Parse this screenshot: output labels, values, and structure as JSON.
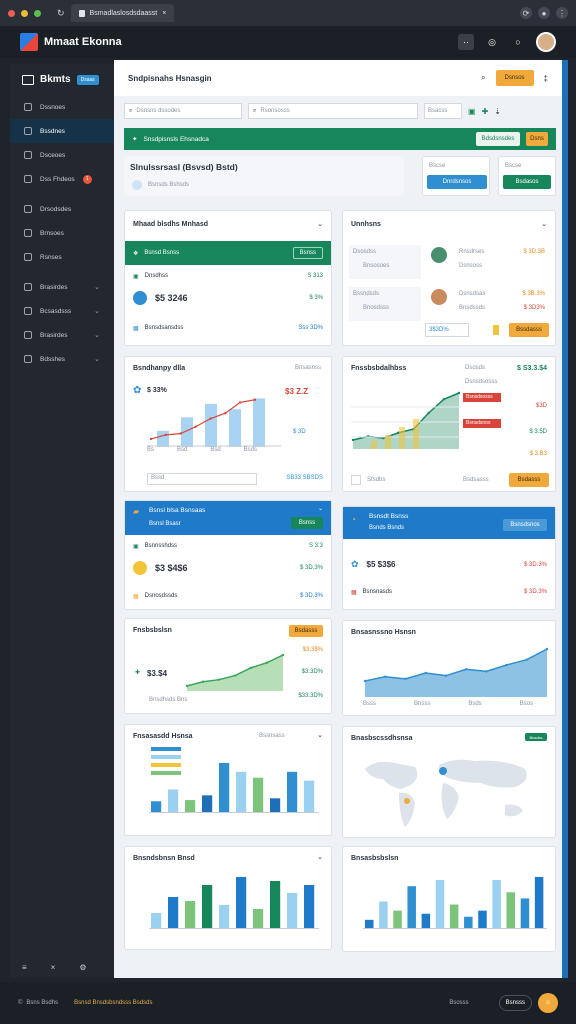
{
  "browser": {
    "tab_title": "Bsmadlaslosdsdaasst",
    "close": "×"
  },
  "app": {
    "name": "Mmaat Ekonna"
  },
  "sidebar": {
    "title": "Bkmts",
    "badge_label": "Dsaas",
    "items": [
      {
        "label": "Dssnoes",
        "icon": "home-icon"
      },
      {
        "label": "Bssdnes",
        "icon": "grid-icon"
      },
      {
        "label": "Dsceoes",
        "icon": "doc-icon"
      },
      {
        "label": "Dss Fhdeos",
        "icon": "user-icon",
        "badge": "1"
      },
      {
        "label": "Drsodsdes",
        "icon": "chart-icon"
      },
      {
        "label": "Brnsoes",
        "icon": "list-icon"
      },
      {
        "label": "Rsnses",
        "icon": "table-icon"
      },
      {
        "label": "Brasirdes",
        "icon": "layers-icon"
      },
      {
        "label": "Bcsasdsss",
        "icon": "cube-icon"
      },
      {
        "label": "Brasirdes",
        "icon": "box-icon"
      },
      {
        "label": "Bdsshes",
        "icon": "settings-icon"
      }
    ]
  },
  "topbar": {
    "title": "Sndpisnahs Hsnasgin",
    "action": "Dsnsos",
    "search1": "Dsnsns dssodes",
    "search2": "Rsonsosss",
    "filter": "Bsacss"
  },
  "banner": {
    "title": "Snsdpisnsls Ehsnadca",
    "btn1": "Bdsdsnsdes",
    "btn2": "Dsns"
  },
  "summary": {
    "title": "Slnulssrsasl (Bsvsd) Bstd)",
    "sub": "Bsnsds Bshsds",
    "btn_top": "Dnrdsnsos",
    "btn_bottom": "Bsdasos",
    "link": "Bscse"
  },
  "card_a": {
    "title": "Mhaad blsdhs Mnhasd",
    "bar": "Bsnsd Bsnss",
    "row1": "Dnsdhss",
    "row1_val": "S 313",
    "value": "$5 3246",
    "delta": "$ 3%",
    "row3": "Bsnsdsansdss",
    "row3_val": "Sss 3D%"
  },
  "card_b": {
    "title": "Unnhsns",
    "r1a": "Dsosdss",
    "r1b": "Bnsosoes",
    "r1val": "$ 3D.3B",
    "r2a": "Rnsdrses",
    "r2b": "Dsnsoss",
    "r2val": "$ 3B.3%",
    "r3a": "Bssndsds",
    "r3b": "Bnosdsss",
    "r3val": "$ 3D3%",
    "r4a": "Dsnsdsas",
    "r4b": "Bnsdssds",
    "r4val": "3$3D%",
    "btn": "Bssdasss"
  },
  "card_c": {
    "title": "Bsndhanpy dlla",
    "sel": "Bnsasnss",
    "value": "$ 33%",
    "val2": "$3 Z.Z",
    "val3": "$ 3D",
    "foot1": "Bssd",
    "foot2": "SB33 SBSDS"
  },
  "card_d": {
    "title": "Fnssbsbdalhbss",
    "r1": "Dsosds",
    "v1": "$ S3.3.$4",
    "r2": "Dsnsdsosss",
    "r3": "Bsnsdsosss",
    "v3": "$3D",
    "r4": "Bsnsdsnos",
    "v4": "$ 3.5D",
    "v5": "$ 3.B3",
    "foot": "Sfsdbs",
    "foot2": "Bsdsasss",
    "btn": "Bsdasss"
  },
  "card_e": {
    "title": "Bsnsl blsa Bsnsaas",
    "sub": "Bsnsl Bsasr",
    "btn": "Bsnss",
    "r1": "Bsnnsshdss",
    "v1": "S 3:3",
    "value": "$3 $4$6",
    "delta": "$ 3D.3%",
    "r3": "Dsnosdssds",
    "v3": "$ 3D.3%"
  },
  "card_f": {
    "title": "Bsnsdt Bsnss",
    "sub": "Bsnds Bsnds",
    "btn": "Bsnsdsnos",
    "value": "$5 $3$6",
    "delta": "$ 3D.3%",
    "r2": "Bsnsnasds",
    "v2": "$ 3D.3%"
  },
  "card_g": {
    "title": "Fnsbsbslsn",
    "btn": "Bsdasss",
    "v1": "$3.$4",
    "v2": "$3.3$%",
    "v3": "$3.3D%",
    "v4": "$33.3D%",
    "foot": "Bnsdhsds Bns"
  },
  "card_h": {
    "title": "Bnsasnssno Hsnsn",
    "x": [
      "Bsss",
      "Bnsss",
      "Bsds",
      "Bsos"
    ]
  },
  "card_i": {
    "title": "Fnsasasdd Hsnsa",
    "sel": "Bssnsass"
  },
  "card_j": {
    "title": "Bnasbscssdhsnsa",
    "badge": "Bnsdss"
  },
  "card_k": {
    "title": "Bnsndsbnsn Bnsd"
  },
  "card_l": {
    "title": "Bnsasbsbslsn"
  },
  "footer": {
    "left": "Bsns Bsdhs",
    "mid": "Bsnsd Bnsdsbsndsss Bsdsds",
    "right": "Bsosss",
    "user": "Bsnsss"
  },
  "colors": {
    "green": "#17865b",
    "blue": "#1f7ac9",
    "orange": "#f2a93b",
    "red": "#d9443a"
  },
  "chart_data": [
    {
      "type": "area",
      "title": "Bsndhanpy dlla",
      "x": [
        "Bs",
        "Bsd",
        "Bsd",
        "Bsds"
      ],
      "values": [
        12,
        18,
        20,
        30,
        42,
        50,
        66,
        70
      ],
      "series_bars": [
        30,
        55,
        80,
        70,
        90
      ]
    },
    {
      "type": "area",
      "title": "Fnssbsbdalhbss",
      "values": [
        10,
        14,
        12,
        18,
        22,
        40,
        55,
        62
      ]
    },
    {
      "type": "area",
      "title": "Fnsbsbslsn",
      "values": [
        10,
        18,
        22,
        30,
        45,
        55,
        70
      ]
    },
    {
      "type": "area",
      "title": "Bnsasnssno Hsnsn",
      "values": [
        30,
        38,
        34,
        45,
        40,
        52,
        48,
        60,
        70,
        90
      ]
    },
    {
      "type": "bar",
      "title": "Fnsasasdd Hsnsa",
      "values": [
        20,
        40,
        22,
        30,
        85,
        70,
        60,
        25,
        70,
        55
      ]
    },
    {
      "type": "bar",
      "title": "Bnsndsbnsn Bnsd",
      "values": [
        20,
        40,
        35,
        55,
        30,
        65,
        25,
        60,
        45,
        55
      ]
    },
    {
      "type": "bar",
      "title": "Bnsasbsbslsn",
      "values": [
        15,
        45,
        30,
        70,
        25,
        80,
        40,
        20,
        30,
        80,
        60,
        50,
        85
      ]
    }
  ]
}
